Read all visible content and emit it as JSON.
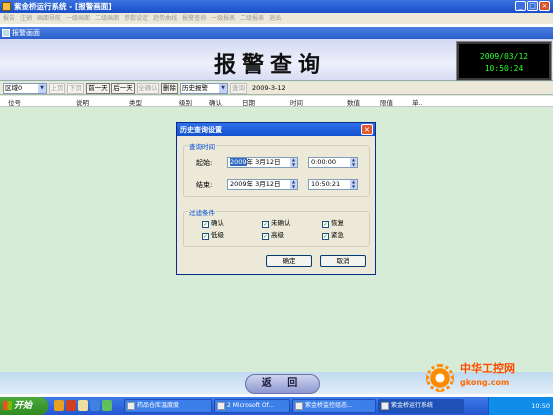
{
  "window": {
    "title": "紫金桥运行系统 - [报警画面]",
    "buttons": {
      "minimize": "_",
      "maximize": "□",
      "close": "×"
    }
  },
  "menu": [
    "报告",
    "注销",
    "画面导航",
    "一级画面",
    "二级画面",
    "参数设定",
    "趋势曲线",
    "报警查询",
    "一级报表",
    "二级报表",
    "退出"
  ],
  "child_window": {
    "title": "报警画面"
  },
  "banner": {
    "title": "报警查询",
    "clock_date": "2009/03/12",
    "clock_time": "10:50:24"
  },
  "toolbar": {
    "area_value": "区域0",
    "prev_page": "上页",
    "next_page": "下页",
    "prev_day": "前一天",
    "next_day": "后一天",
    "confirm": "全确认",
    "delete": "删除",
    "history_value": "历史报警",
    "query": "查询",
    "date": "2009-3-12"
  },
  "table_headers": [
    "位号",
    "说明",
    "类型",
    "级别",
    "确认",
    "日期",
    "时间",
    "数值",
    "限值",
    "单.."
  ],
  "dialog": {
    "title": "历史查询设置",
    "close": "×",
    "time_group": "查询时间",
    "start_label": "起始:",
    "start_year": "2009",
    "start_date_rest": "年 3月12日",
    "start_time": "0:00:00",
    "end_label": "结束:",
    "end_date": "2009年 3月12日",
    "end_time": "10:50:21",
    "filter_group": "过滤条件",
    "filters": [
      {
        "label": "确认",
        "checked": true
      },
      {
        "label": "未确认",
        "checked": true
      },
      {
        "label": "恢复",
        "checked": true
      },
      {
        "label": "低级",
        "checked": true
      },
      {
        "label": "高级",
        "checked": true
      },
      {
        "label": "紧急",
        "checked": true
      }
    ],
    "ok": "确定",
    "cancel": "取消"
  },
  "return_button": "返 回",
  "watermark": {
    "line1": "中华工控网",
    "line2": "gkong.com"
  },
  "taskbar": {
    "start": "开始",
    "tasks": [
      "药品仓库温度度",
      "2 Microsoft Of...",
      "紫金桥监控组态...",
      "紫金桥运行系统"
    ],
    "time": "10:50"
  }
}
